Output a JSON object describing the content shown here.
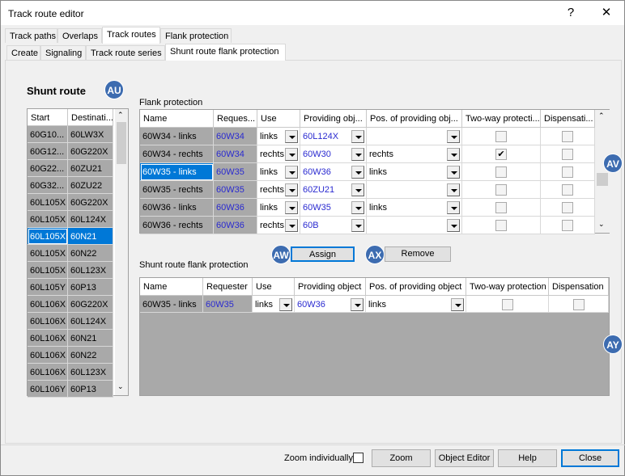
{
  "window": {
    "title": "Track route editor",
    "help": "?",
    "close": "✕"
  },
  "tabs1": [
    "Track paths",
    "Overlaps",
    "Track routes",
    "Flank protection"
  ],
  "tabs2": [
    "Create",
    "Signaling",
    "Track route series",
    "Shunt route flank protection"
  ],
  "badges": {
    "au": "AU",
    "av": "AV",
    "aw": "AW",
    "ax": "AX",
    "ay": "AY"
  },
  "shunt": {
    "title": "Shunt route",
    "headers": [
      "Start",
      "Destinati..."
    ],
    "rows": [
      [
        "60G10...",
        "60LW3X"
      ],
      [
        "60G12...",
        "60G220X"
      ],
      [
        "60G22...",
        "60ZU21"
      ],
      [
        "60G32...",
        "60ZU22"
      ],
      [
        "60L105X",
        "60G220X"
      ],
      [
        "60L105X",
        "60L124X"
      ],
      [
        "60L105X",
        "60N21"
      ],
      [
        "60L105X",
        "60N22"
      ],
      [
        "60L105X",
        "60L123X"
      ],
      [
        "60L105Y",
        "60P13"
      ],
      [
        "60L106X",
        "60G220X"
      ],
      [
        "60L106X",
        "60L124X"
      ],
      [
        "60L106X",
        "60N21"
      ],
      [
        "60L106X",
        "60N22"
      ],
      [
        "60L106X",
        "60L123X"
      ],
      [
        "60L106Y",
        "60P13"
      ]
    ],
    "selected": 6
  },
  "flank": {
    "label": "Flank protection",
    "headers": [
      "Name",
      "Reques...",
      "Use",
      "Providing obj...",
      "Pos. of providing obj...",
      "Two-way protecti...",
      "Dispensati..."
    ],
    "rows": [
      [
        "60W34 - links",
        "60W34",
        "links",
        "60L124X",
        "",
        false,
        false
      ],
      [
        "60W34 - rechts",
        "60W34",
        "rechts",
        "60W30",
        "rechts",
        true,
        false
      ],
      [
        "60W35 - links",
        "60W35",
        "links",
        "60W36",
        "links",
        false,
        false
      ],
      [
        "60W35 - rechts",
        "60W35",
        "rechts",
        "60ZU21",
        "",
        false,
        false
      ],
      [
        "60W36 - links",
        "60W36",
        "links",
        "60W35",
        "links",
        false,
        false
      ],
      [
        "60W36 - rechts",
        "60W36",
        "rechts",
        "60B",
        "",
        false,
        false
      ]
    ],
    "selected": 2
  },
  "actions": {
    "assign": "Assign",
    "remove": "Remove"
  },
  "srfp": {
    "label": "Shunt route flank protection",
    "headers": [
      "Name",
      "Requester",
      "Use",
      "Providing object",
      "Pos. of providing object",
      "Two-way protection",
      "Dispensation"
    ],
    "rows": [
      [
        "60W35 - links",
        "60W35",
        "links",
        "60W36",
        "links",
        false,
        false
      ]
    ]
  },
  "footer": {
    "zoom_individually": "Zoom individually",
    "zoom_individually_checked": false,
    "zoom": "Zoom",
    "object_editor": "Object Editor",
    "help": "Help",
    "close": "Close"
  },
  "colors": {
    "selection": "#0078d7",
    "badge": "#3d6cb0",
    "link_text": "#2a2ad0"
  }
}
